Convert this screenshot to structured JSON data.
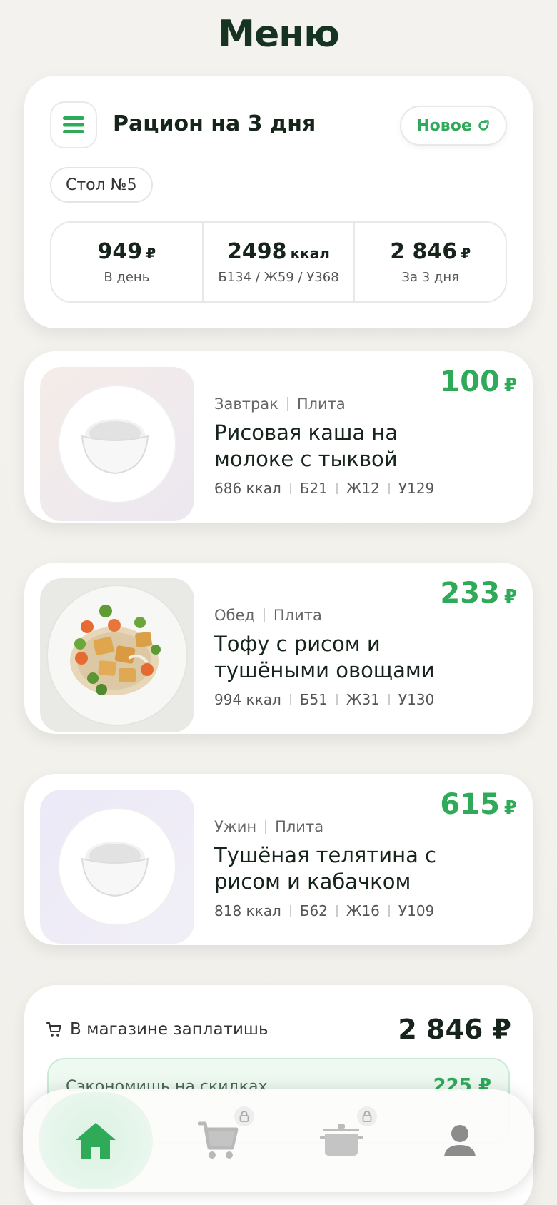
{
  "page": {
    "title": "Меню"
  },
  "summary": {
    "plan_title": "Рацион на 3 дня",
    "new_button": "Новое",
    "diet_chip": "Стол №5",
    "stats": [
      {
        "value": "949",
        "unit": "₽",
        "label": "В день"
      },
      {
        "value": "2498",
        "unit": "ккал",
        "label": "Б134 / Ж59 / У368"
      },
      {
        "value": "2 846",
        "unit": "₽",
        "label": "За 3 дня"
      }
    ]
  },
  "meals": [
    {
      "meal": "Завтрак",
      "method": "Плита",
      "name_line1": "Рисовая каша на",
      "name_line2": "молоке с тыквой",
      "price": "100",
      "currency": "₽",
      "kcal": "686 ккал",
      "p": "Б21",
      "f": "Ж12",
      "c": "У129",
      "image_icon": "rice-bowl-icon"
    },
    {
      "meal": "Обед",
      "method": "Плита",
      "name_line1": "Тофу с рисом и",
      "name_line2": "тушёными овощами",
      "price": "233",
      "currency": "₽",
      "kcal": "994 ккал",
      "p": "Б51",
      "f": "Ж31",
      "c": "У130",
      "image_icon": "tofu-plate-icon"
    },
    {
      "meal": "Ужин",
      "method": "Плита",
      "name_line1": "Тушёная телятина с",
      "name_line2": "рисом и кабачком",
      "price": "615",
      "currency": "₽",
      "kcal": "818 ккал",
      "p": "Б62",
      "f": "Ж16",
      "c": "У109",
      "image_icon": "rice-bowl-icon"
    }
  ],
  "shop": {
    "label": "В магазине заплатишь",
    "total": "2 846 ₽",
    "inner_label": "Сэкономишь на скидках",
    "inner_value": "225 ₽"
  },
  "nav": {
    "items": [
      {
        "name": "home",
        "icon": "home-icon",
        "locked": false,
        "active": true
      },
      {
        "name": "cart",
        "icon": "cart-icon",
        "locked": true
      },
      {
        "name": "pot",
        "icon": "pot-icon",
        "locked": true
      },
      {
        "name": "profile",
        "icon": "user-icon",
        "locked": false
      }
    ]
  },
  "colors": {
    "accent": "#2eaa59",
    "text": "#16241b",
    "background": "#f3f1ec"
  }
}
